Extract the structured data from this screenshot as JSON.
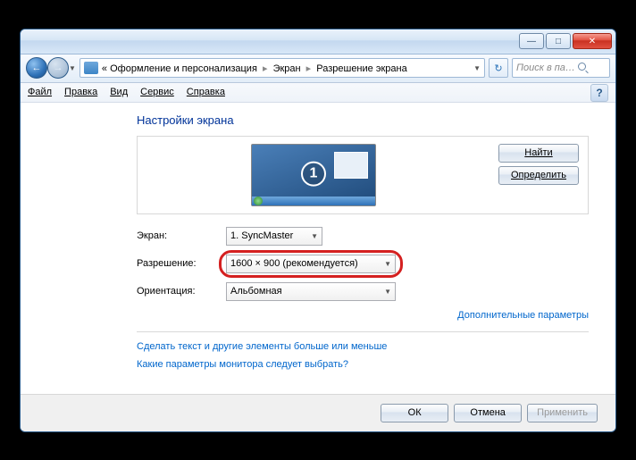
{
  "titlebar": {
    "minimize": "—",
    "maximize": "□",
    "close": "✕"
  },
  "nav": {
    "back": "←",
    "forward": "→",
    "dropdown": "▼",
    "breadcrumb_prefix": "«",
    "breadcrumb1": "Оформление и персонализация",
    "breadcrumb2": "Экран",
    "breadcrumb3": "Разрешение экрана",
    "sep": "▸",
    "refresh": "↻",
    "search_placeholder": "Поиск в па…"
  },
  "menu": {
    "file": "Файл",
    "edit": "Правка",
    "view": "Вид",
    "tools": "Сервис",
    "help": "Справка"
  },
  "page": {
    "heading": "Настройки экрана",
    "monitor_number": "1",
    "find_btn": "Найти",
    "detect_btn": "Определить",
    "label_display": "Экран:",
    "value_display": "1. SyncMaster",
    "label_resolution": "Разрешение:",
    "value_resolution": "1600 × 900 (рекомендуется)",
    "label_orientation": "Ориентация:",
    "value_orientation": "Альбомная",
    "link_advanced": "Дополнительные параметры",
    "link_textsize": "Сделать текст и другие элементы больше или меньше",
    "link_whichmonitor": "Какие параметры монитора следует выбрать?"
  },
  "footer": {
    "ok": "ОК",
    "cancel": "Отмена",
    "apply": "Применить"
  },
  "help": "?"
}
